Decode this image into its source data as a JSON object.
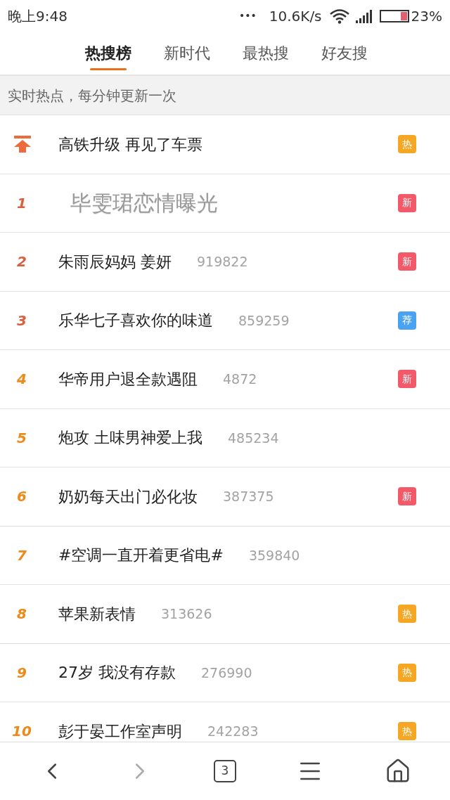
{
  "status_bar": {
    "time": "晚上9:48",
    "dots": "•••",
    "speed": "10.6K/s",
    "battery": "23%"
  },
  "tabs": [
    {
      "label": "热搜榜",
      "selected": true
    },
    {
      "label": "新时代",
      "selected": false
    },
    {
      "label": "最热搜",
      "selected": false
    },
    {
      "label": "好友搜",
      "selected": false
    }
  ],
  "notice": "实时热点，每分钟更新一次",
  "items": [
    {
      "kind": "pinned",
      "title": "高铁升级 再见了车票",
      "badge": "热",
      "color": "#f5a623"
    },
    {
      "kind": "overlay",
      "rank": "1",
      "title": "毕雯珺恋情曝光",
      "badge": "新",
      "color": "#f25a6a"
    },
    {
      "kind": "normal",
      "rank": "2",
      "title": "朱雨辰妈妈 姜妍",
      "count": "919822",
      "badge": "新",
      "color": "#f25a6a"
    },
    {
      "kind": "normal",
      "rank": "3",
      "title": "乐华七子喜欢你的味道",
      "count": "859259",
      "badge": "荐",
      "color": "#4aa3f0"
    },
    {
      "kind": "normal",
      "rank": "4",
      "title": "华帝用户退全款遇阻",
      "count": "4872",
      "badge": "新",
      "color": "#f25a6a"
    },
    {
      "kind": "normal",
      "rank": "5",
      "title": "炮攻 土味男神爱上我",
      "count": "485234"
    },
    {
      "kind": "normal",
      "rank": "6",
      "title": "奶奶每天出门必化妆",
      "count": "387375",
      "badge": "新",
      "color": "#f25a6a"
    },
    {
      "kind": "normal",
      "rank": "7",
      "title": "#空调一直开着更省电#",
      "count": "359840"
    },
    {
      "kind": "normal",
      "rank": "8",
      "title": "苹果新表情",
      "count": "313626",
      "badge": "热",
      "color": "#f5a623"
    },
    {
      "kind": "normal",
      "rank": "9",
      "title": "27岁 我没有存款",
      "count": "276990",
      "badge": "热",
      "color": "#f5a623"
    },
    {
      "kind": "normal",
      "rank": "10",
      "title": "彭于晏工作室声明",
      "count": "242283",
      "badge": "热",
      "color": "#f5a623"
    }
  ],
  "bottom_bar": {
    "tab_count": "3"
  }
}
